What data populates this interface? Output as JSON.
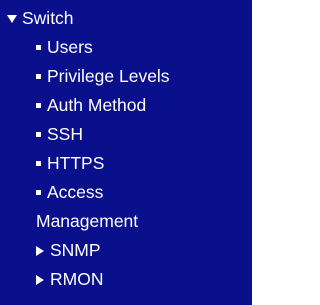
{
  "colors": {
    "menu_background": "#0a0f8c",
    "menu_text": "#ffffff"
  },
  "menu": {
    "section": {
      "label": "Switch",
      "icon": "triangle-down-icon"
    },
    "items": [
      {
        "label": "Users",
        "icon": "bullet-square-icon"
      },
      {
        "label": "Privilege Levels",
        "icon": "bullet-square-icon"
      },
      {
        "label": "Auth Method",
        "icon": "bullet-square-icon"
      },
      {
        "label": "SSH",
        "icon": "bullet-square-icon"
      },
      {
        "label": "HTTPS",
        "icon": "bullet-square-icon"
      },
      {
        "label": "Access",
        "continuation": "Management",
        "icon": "bullet-square-icon"
      }
    ],
    "subsections": [
      {
        "label": "SNMP",
        "icon": "triangle-right-icon"
      },
      {
        "label": "RMON",
        "icon": "triangle-right-icon"
      }
    ]
  }
}
